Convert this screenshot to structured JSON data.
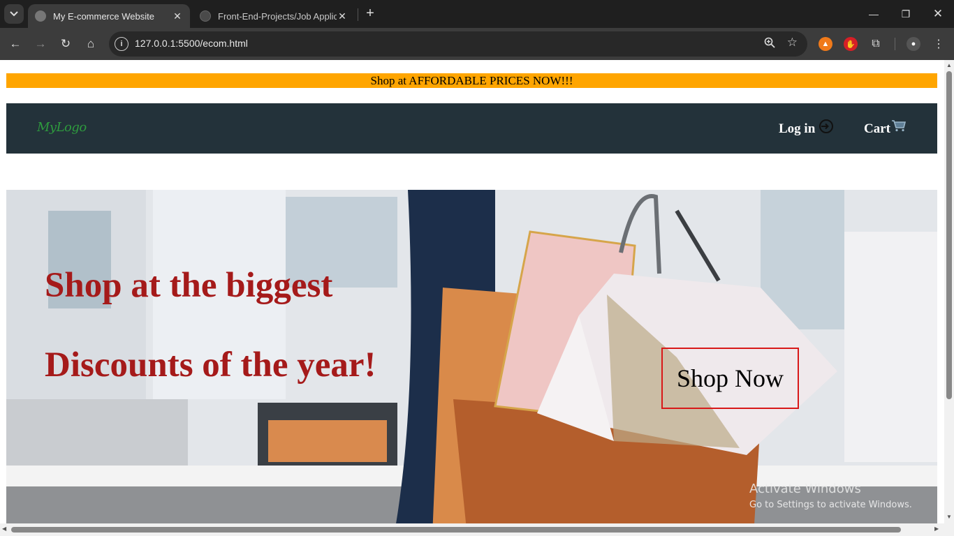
{
  "browser": {
    "tabs": [
      {
        "title": "My E-commerce Website",
        "active": true
      },
      {
        "title": "Front-End-Projects/Job Applicat",
        "active": false
      }
    ],
    "url": "127.0.0.1:5500/ecom.html"
  },
  "page": {
    "promo_text": "Shop at AFFORDABLE PRICES NOW!!!",
    "logo": "MyLogo",
    "nav": {
      "login_label": "Log in",
      "cart_label": "Cart"
    },
    "hero": {
      "line1": "Shop at the biggest",
      "line2": "Discounts of the year!",
      "cta_label": "Shop Now"
    },
    "colors": {
      "promo_bg": "#ffa500",
      "nav_bg": "#23323a",
      "logo": "#2e9b3e",
      "headline": "#a51a1a",
      "cta_border": "#d81818"
    }
  },
  "os_watermark": {
    "title": "Activate Windows",
    "subtitle": "Go to Settings to activate Windows."
  }
}
